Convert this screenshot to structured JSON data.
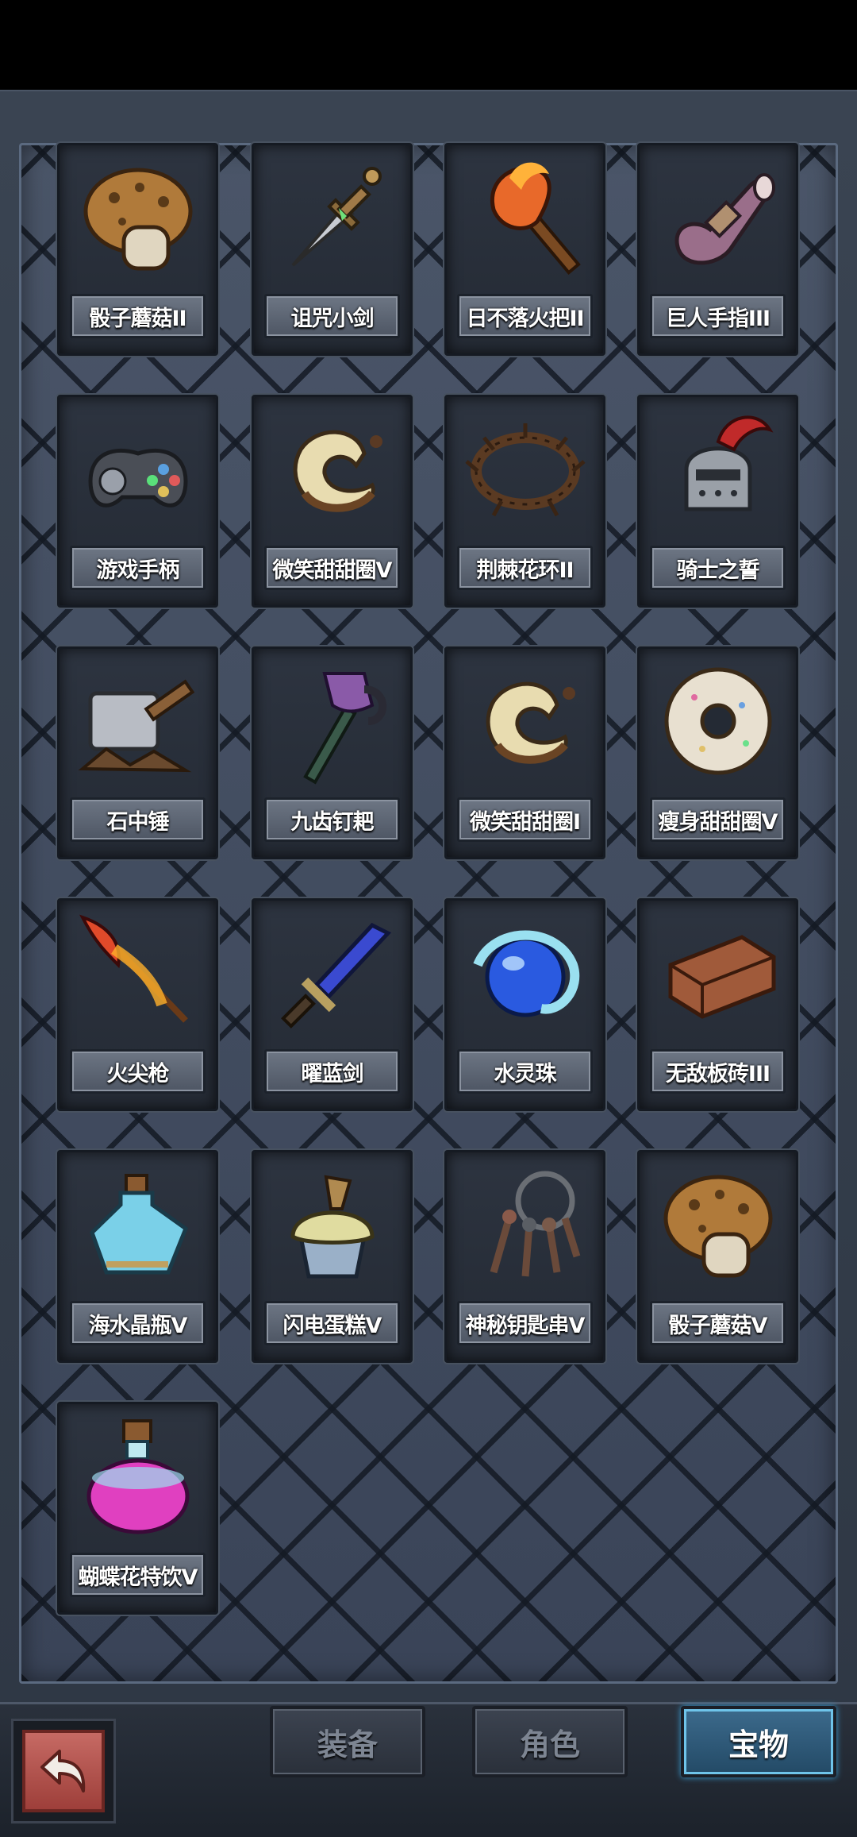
{
  "items": [
    {
      "name": "骰子蘑菇II",
      "icon": "dice-mushroom-icon",
      "art": "mushroom"
    },
    {
      "name": "诅咒小剑",
      "icon": "cursed-dagger-icon",
      "art": "dagger"
    },
    {
      "name": "日不落火把II",
      "icon": "torch-icon",
      "art": "torch"
    },
    {
      "name": "巨人手指III",
      "icon": "giant-finger-icon",
      "art": "finger"
    },
    {
      "name": "游戏手柄",
      "icon": "gamepad-icon",
      "art": "gamepad"
    },
    {
      "name": "微笑甜甜圈V",
      "icon": "smile-donut-icon",
      "art": "cdonut"
    },
    {
      "name": "荆棘花环II",
      "icon": "thorn-wreath-icon",
      "art": "wreath"
    },
    {
      "name": "骑士之誓",
      "icon": "knight-helmet-icon",
      "art": "helmet"
    },
    {
      "name": "石中锤",
      "icon": "stone-hammer-icon",
      "art": "hammer"
    },
    {
      "name": "九齿钉耙",
      "icon": "nine-tooth-rake-icon",
      "art": "rake"
    },
    {
      "name": "微笑甜甜圈I",
      "icon": "smile-donut-icon",
      "art": "cdonut"
    },
    {
      "name": "瘦身甜甜圈V",
      "icon": "slim-donut-icon",
      "art": "donut"
    },
    {
      "name": "火尖枪",
      "icon": "fire-spear-icon",
      "art": "spear"
    },
    {
      "name": "曜蓝剑",
      "icon": "blue-sword-icon",
      "art": "sword"
    },
    {
      "name": "水灵珠",
      "icon": "water-orb-icon",
      "art": "orb"
    },
    {
      "name": "无敌板砖III",
      "icon": "brick-icon",
      "art": "brick"
    },
    {
      "name": "海水晶瓶V",
      "icon": "crystal-bottle-icon",
      "art": "bottle"
    },
    {
      "name": "闪电蛋糕V",
      "icon": "lightning-cake-icon",
      "art": "cake"
    },
    {
      "name": "神秘钥匙串V",
      "icon": "key-ring-icon",
      "art": "keys"
    },
    {
      "name": "骰子蘑菇V",
      "icon": "dice-mushroom-icon",
      "art": "mushroom"
    },
    {
      "name": "蝴蝶花特饮V",
      "icon": "potion-icon",
      "art": "potion"
    }
  ],
  "tabs": [
    {
      "label": "装备",
      "active": false
    },
    {
      "label": "角色",
      "active": false
    },
    {
      "label": "宝物",
      "active": true
    }
  ],
  "back_button": {
    "icon": "return-arrow-icon"
  }
}
